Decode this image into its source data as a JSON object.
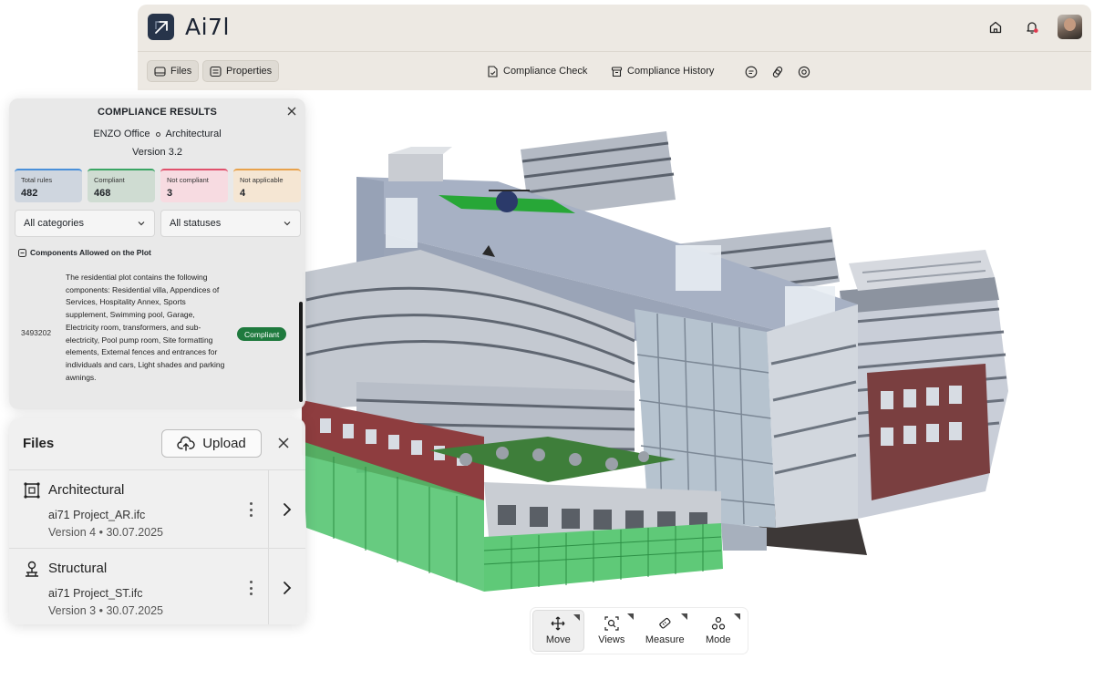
{
  "app": {
    "logo_text": "Ai7l"
  },
  "toolbar": {
    "files_label": "Files",
    "properties_label": "Properties",
    "compliance_check_label": "Compliance Check",
    "compliance_history_label": "Compliance History"
  },
  "dock": {
    "move_label": "Move",
    "views_label": "Views",
    "measure_label": "Measure",
    "mode_label": "Mode",
    "active": "Move"
  },
  "compliance": {
    "title": "COMPLIANCE RESULTS",
    "project": "ENZO Office",
    "discipline": "Architectural",
    "version": "Version 3.2",
    "stats": [
      {
        "label": "Total rules",
        "value": "482",
        "color": "#4a90d9",
        "bg": "#cfd6df"
      },
      {
        "label": "Compliant",
        "value": "468",
        "color": "#3aa564",
        "bg": "#cfdcd2"
      },
      {
        "label": "Not compliant",
        "value": "3",
        "color": "#e0526d",
        "bg": "#f7dbe1"
      },
      {
        "label": "Not applicable",
        "value": "4",
        "color": "#e8a24c",
        "bg": "#f5e6d3"
      }
    ],
    "filter_category": "All categories",
    "filter_status": "All statuses",
    "section_title": "Components Allowed on the Plot",
    "row": {
      "id": "3493202",
      "description": "The residential plot contains the following components: Residential villa, Appendices of Services, Hospitality Annex, Sports supplement, Swimming pool, Garage, Electricity room, transformers, and sub-electricity, Pool pump room, Site formatting elements, External fences and entrances for individuals and cars, Light shades and parking awnings.",
      "status": "Compliant"
    }
  },
  "files": {
    "title": "Files",
    "upload_label": "Upload",
    "items": [
      {
        "name": "Architectural",
        "file": "ai71 Project_AR.ifc",
        "meta": "Version 4 • 30.07.2025",
        "icon": "architectural-icon"
      },
      {
        "name": "Structural",
        "file": "ai71 Project_ST.ifc",
        "meta": "Version 3 • 30.07.2025",
        "icon": "structural-icon"
      }
    ]
  }
}
